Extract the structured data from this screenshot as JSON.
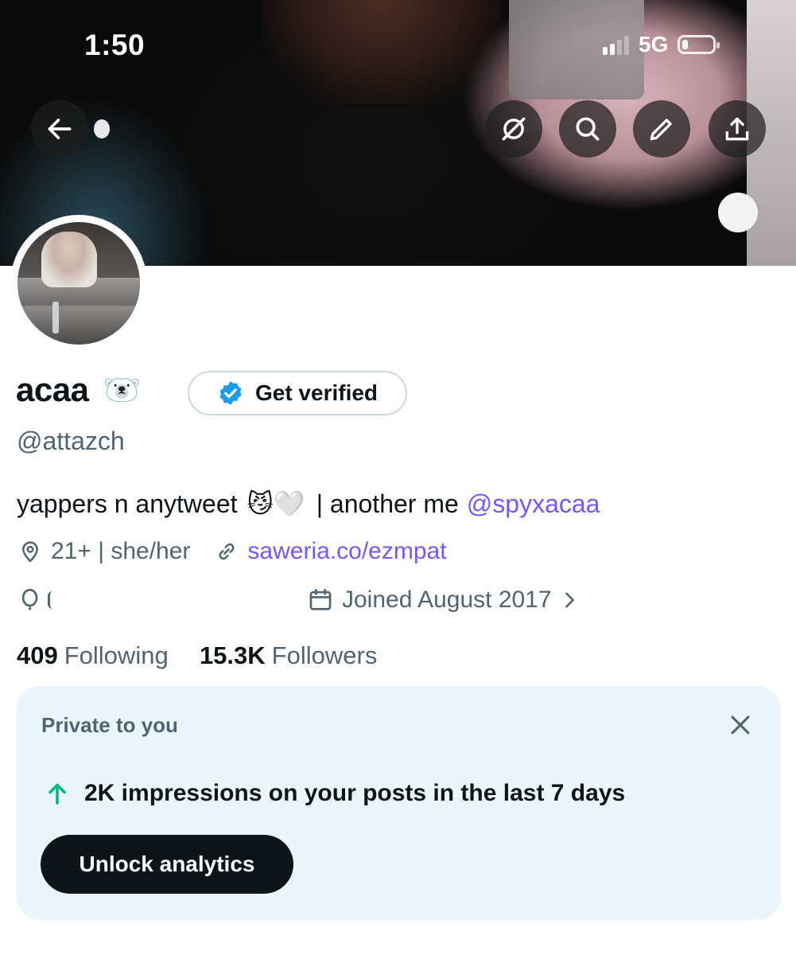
{
  "status_bar": {
    "time": "1:50",
    "network": "5G",
    "signal_bars_active": 2,
    "battery_level_fraction": 0.2
  },
  "header_actions": {
    "back_icon": "arrow-left-icon",
    "grok_icon": "grok-icon",
    "search_icon": "search-icon",
    "edit_icon": "pencil-icon",
    "share_icon": "share-icon"
  },
  "profile": {
    "name": "acaa",
    "name_emoji": "🐻‍❄️",
    "verify_button": "Get verified",
    "handle": "@attazch",
    "bio": {
      "text": "yappers n anytweet",
      "emojis": "😼🤍",
      "separator": "| another me",
      "mention": "@spyxacaa"
    },
    "location": "21+ | she/her",
    "website": "saweria.co/ezmpat",
    "birthday": "",
    "joined": "Joined August 2017",
    "following_count": "409",
    "following_label": "Following",
    "followers_count": "15.3K",
    "followers_label": "Followers"
  },
  "private_card": {
    "title": "Private to you",
    "impressions_text": "2K impressions on your posts in the last 7 days",
    "unlock_button": "Unlock analytics"
  },
  "colors": {
    "accent_link": "#7856ff",
    "verified_blue": "#1d9bf0",
    "trend_up_green": "#00ba7c",
    "card_bg": "#eaf6fc",
    "text_secondary": "#536471"
  }
}
